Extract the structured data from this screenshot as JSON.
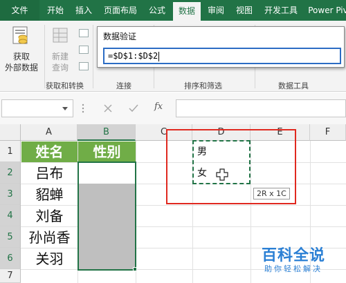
{
  "ribbon_tabs": [
    {
      "label": "文件",
      "state": "file"
    },
    {
      "label": "开始",
      "state": "normal"
    },
    {
      "label": "插入",
      "state": "normal"
    },
    {
      "label": "页面布局",
      "state": "normal"
    },
    {
      "label": "公式",
      "state": "normal"
    },
    {
      "label": "数据",
      "state": "active"
    },
    {
      "label": "审阅",
      "state": "normal"
    },
    {
      "label": "视图",
      "state": "normal"
    },
    {
      "label": "开发工具",
      "state": "normal"
    },
    {
      "label": "Power Piv",
      "state": "normal"
    }
  ],
  "ribbon": {
    "get_external_data": "获取\n外部数据",
    "new_query": "新建\n查询",
    "groups": {
      "get_transform": "获取和转换",
      "connections": "连接",
      "sort_filter": "排序和筛选",
      "data_tools": "数据工具"
    }
  },
  "dialog": {
    "title": "数据验证",
    "formula": "=$D$1:$D$2"
  },
  "formula_bar": {
    "fx_label": "fx",
    "cancel_icon": "close-icon",
    "confirm_icon": "check-icon"
  },
  "sheet": {
    "columns": [
      "A",
      "B",
      "C",
      "D",
      "E",
      "F"
    ],
    "rows": [
      "1",
      "2",
      "3",
      "4",
      "5",
      "6",
      "7"
    ],
    "header_name": "姓名",
    "header_gender": "性别",
    "names": [
      "吕布",
      "貂蝉",
      "刘备",
      "孙尚香",
      "关羽"
    ],
    "d_values": [
      "男",
      "女"
    ],
    "size_tooltip": "2R x 1C"
  },
  "colors": {
    "excel_green": "#217346",
    "header_fill": "#70ad47",
    "highlight_red": "#e0281f",
    "watermark_blue": "#2a7fd4"
  },
  "watermark": {
    "title": "百科全说",
    "subtitle": "助你轻松解决"
  }
}
